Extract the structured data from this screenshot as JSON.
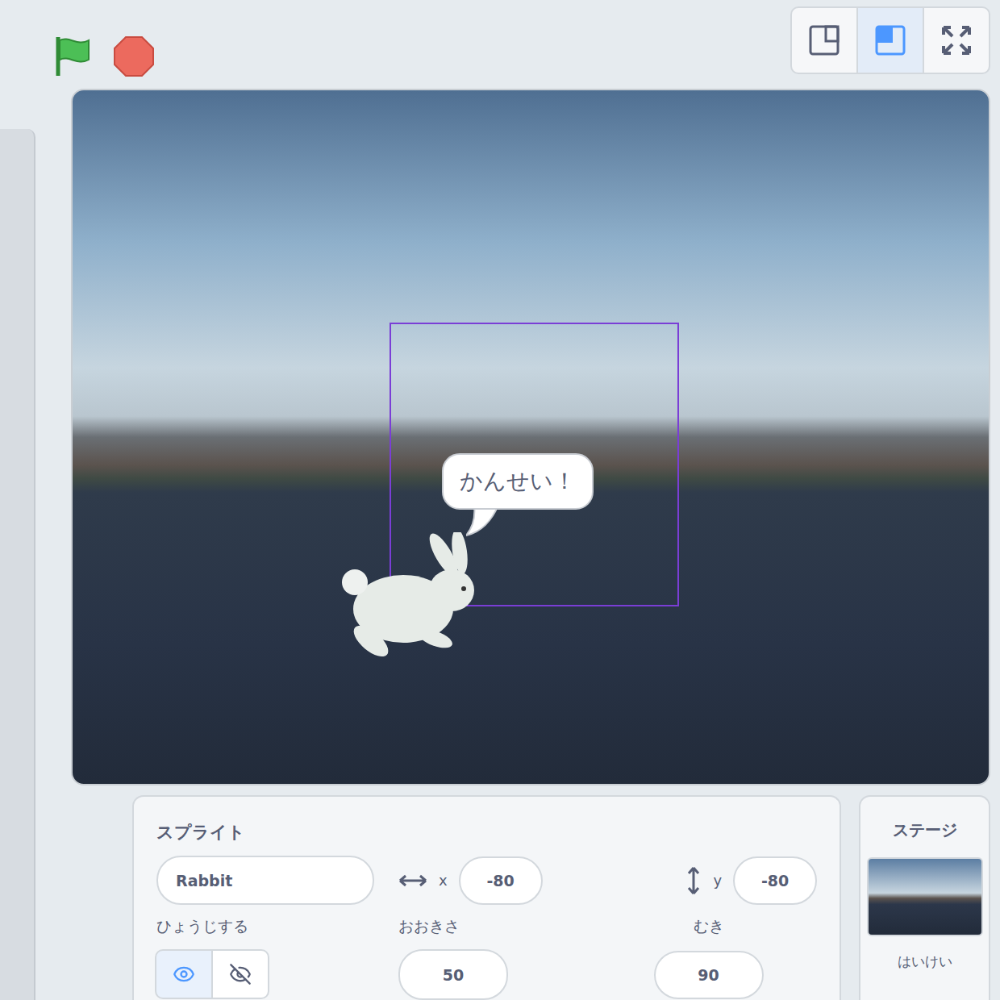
{
  "toolbar": {
    "stage_modes": [
      {
        "kind": "small",
        "selected": false
      },
      {
        "kind": "large",
        "selected": true
      },
      {
        "kind": "fullscreen",
        "selected": false
      }
    ]
  },
  "stage": {
    "sprite": {
      "say": "かんせい！",
      "selected": true
    }
  },
  "sprite_info": {
    "heading": "スプライト",
    "name": "Rabbit",
    "x_label": "x",
    "x": "-80",
    "y_label": "y",
    "y": "-80",
    "show_label": "ひょうじする",
    "visibility": [
      {
        "kind": "show",
        "selected": true
      },
      {
        "kind": "hide",
        "selected": false
      }
    ],
    "size_label": "おおきさ",
    "size": "50",
    "direction_label": "むき",
    "direction": "90"
  },
  "stage_panel": {
    "heading": "ステージ",
    "backdrop_label": "はいけい"
  }
}
